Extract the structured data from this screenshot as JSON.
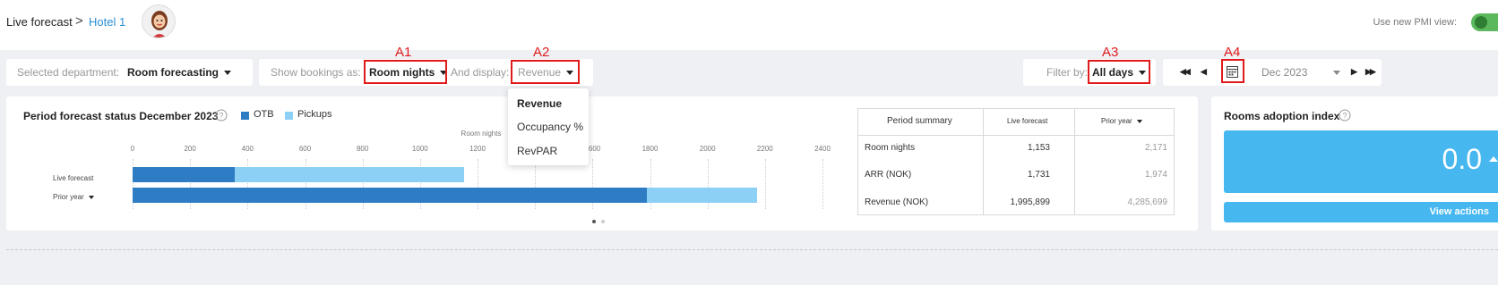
{
  "header": {
    "breadcrumb_root": "Live forecast",
    "breadcrumb_separator": ">",
    "breadcrumb_hotel": "Hotel 1",
    "pmi_label": "Use new PMI view:",
    "pmi_toggle_on": true
  },
  "toolbar": {
    "department_label": "Selected department:",
    "department_value": "Room forecasting",
    "bookings_label": "Show bookings as:",
    "bookings_value": "Room nights",
    "display_label": "And display:",
    "display_value": "Revenue",
    "filter_label": "Filter by:",
    "filter_value": "All days",
    "month_value": "Dec 2023",
    "nav_first": "◀◀",
    "nav_prev": "◀",
    "nav_next": "▶",
    "nav_last": "▶▶"
  },
  "annotations": {
    "a1": "A1",
    "a2": "A2",
    "a3": "A3",
    "a4": "A4"
  },
  "annotation_color": "#e01b1b",
  "display_dropdown": {
    "options": [
      "Revenue",
      "Occupancy %",
      "RevPAR"
    ],
    "selected": "Revenue"
  },
  "forecast_card": {
    "title": "Period forecast status December 2023",
    "help_icon": "question-circle-icon",
    "legend": [
      {
        "label": "OTB",
        "color": "#2e7dc4"
      },
      {
        "label": "Pickups",
        "color": "#8dd0f5"
      }
    ],
    "pager": "• •"
  },
  "chart_data": {
    "type": "bar",
    "orientation": "horizontal",
    "stacked": true,
    "xlabel": "Room nights",
    "xlim": [
      0,
      2400
    ],
    "ticks": [
      0,
      200,
      400,
      600,
      800,
      1000,
      1200,
      1400,
      1600,
      1800,
      2000,
      2200,
      2400
    ],
    "categories": [
      "Live forecast",
      "Prior year"
    ],
    "series": [
      {
        "name": "OTB",
        "values": [
          355,
          1790
        ]
      },
      {
        "name": "Pickups",
        "values": [
          798,
          381
        ]
      }
    ],
    "grid": true,
    "legend": "top-left"
  },
  "summary_table": {
    "headers": [
      "Period summary",
      "Live forecast",
      "Prior year"
    ],
    "rows": [
      {
        "label": "Room nights",
        "live": "1,153",
        "prior": "2,171"
      },
      {
        "label": "ARR (NOK)",
        "live": "1,731",
        "prior": "1,974"
      },
      {
        "label": "Revenue (NOK)",
        "live": "1,995,899",
        "prior": "4,285,699"
      }
    ]
  },
  "adoption": {
    "title": "Rooms adoption index",
    "value": "0.0",
    "button_label": "View actions",
    "accent": "#46b7ef"
  }
}
